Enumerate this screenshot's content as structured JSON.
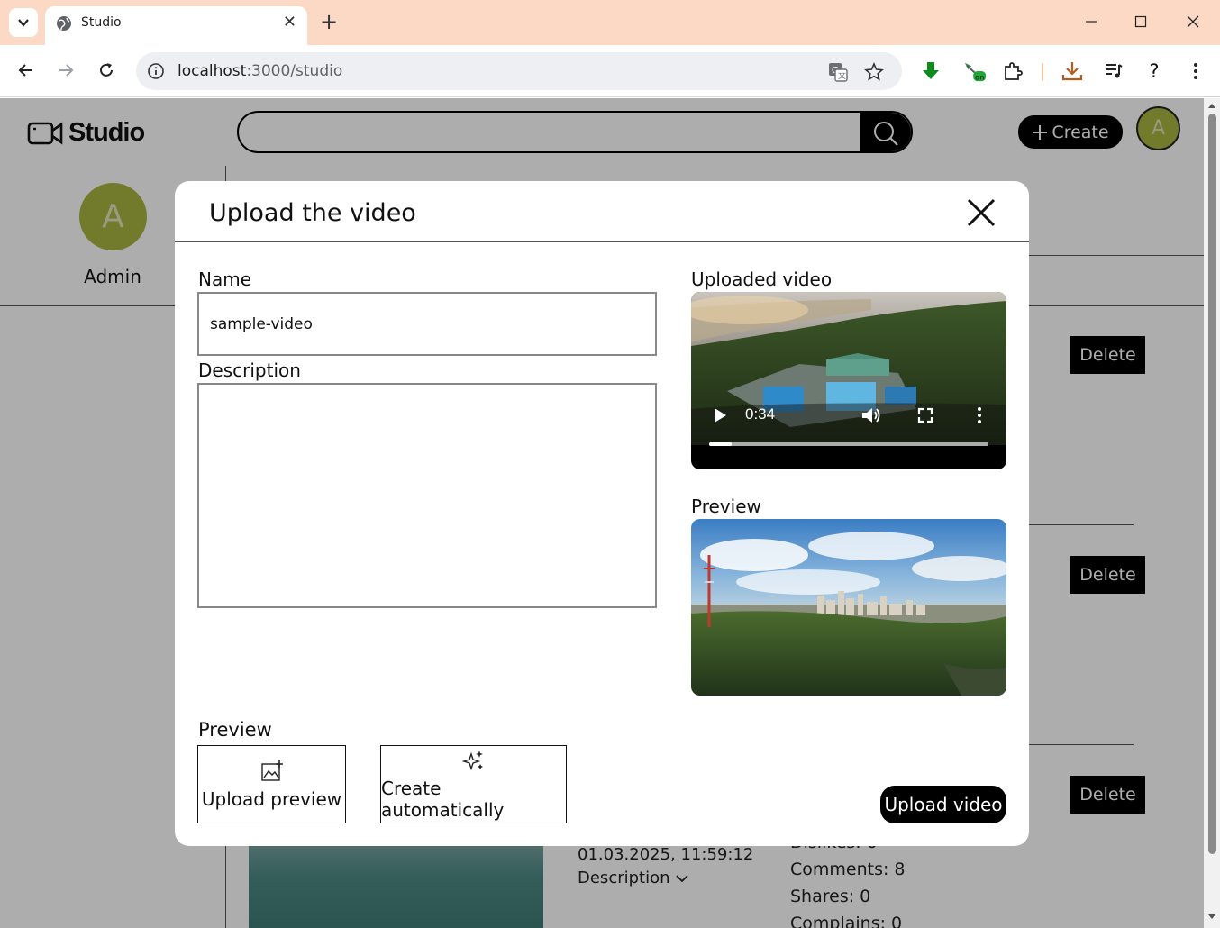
{
  "browser": {
    "tab_title": "Studio",
    "url_host": "localhost",
    "url_rest": ":3000/studio",
    "ext_badge": "on",
    "icons": [
      "chevron-down-icon",
      "globe-icon",
      "close-icon",
      "plus-icon",
      "minimize-icon",
      "maximize-icon",
      "close-window-icon",
      "back-icon",
      "forward-icon",
      "reload-icon",
      "info-icon",
      "translate-icon",
      "star-icon",
      "download-arrow-icon",
      "extension-icon",
      "puzzle-icon",
      "download-icon",
      "media-icon",
      "help-icon",
      "more-icon"
    ]
  },
  "app": {
    "logo_text": "Studio",
    "search": {
      "placeholder": ""
    },
    "create_label": "Create",
    "user_initial": "A",
    "user_name": "Admin",
    "accent_color": "#a8b440"
  },
  "background": {
    "delete_label": "Delete",
    "date": "01.03.2025, 11:59:12",
    "description_toggle": "Description",
    "stats_partial": "Dislikes: 0",
    "comments": "Comments: 8",
    "shares": "Shares: 0",
    "complains": "Complains: 0"
  },
  "modal": {
    "title": "Upload the video",
    "name_label": "Name",
    "name_value": "sample-video",
    "description_label": "Description",
    "description_value": "",
    "uploaded_video_label": "Uploaded video",
    "video_time": "0:34",
    "video_progress": 0.08,
    "preview_image_label": "Preview",
    "preview_section_label": "Preview",
    "upload_preview_label": "Upload preview",
    "create_auto_label": "Create automatically",
    "upload_video_label": "Upload video"
  }
}
